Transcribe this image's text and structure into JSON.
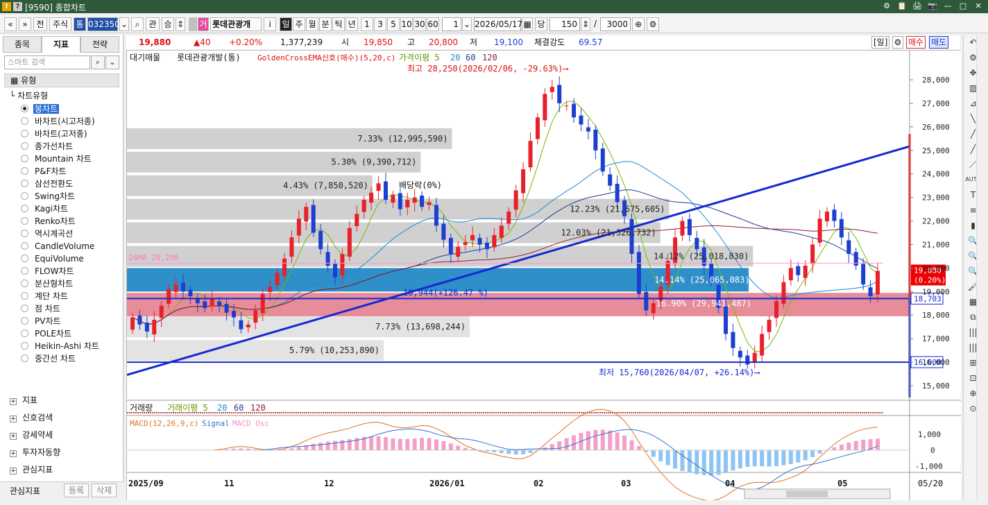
{
  "window": {
    "title": "[9590] 종합차트",
    "icon1": "!",
    "icon2": "?",
    "buttons": [
      "⚙",
      "📋",
      "🖨",
      "📷",
      "—",
      "□",
      "✕"
    ]
  },
  "toolbar": {
    "nav_prev": "«",
    "nav_down": "»",
    "jeon": "전",
    "jusik": "주식",
    "tong": "통",
    "code": "032350",
    "gwan": "관",
    "seung": "승",
    "badge": "거",
    "stock_name": "롯데관광개",
    "info": "i",
    "periods": [
      "일",
      "주",
      "월",
      "분",
      "틱",
      "년"
    ],
    "counts": [
      "1",
      "3",
      "5",
      "10",
      "30",
      "60"
    ],
    "unit": "1",
    "date": "2026/05/17",
    "dang": "당",
    "bars": "150",
    "slash": "/",
    "total": "3000"
  },
  "left_panel": {
    "tabs": [
      "종목",
      "지표",
      "전략"
    ],
    "search_placeholder": "스마트 검색",
    "group": "유형",
    "tree_root": "차트유형",
    "chart_types": [
      "봉차트",
      "바차트(시고저종)",
      "바차트(고저종)",
      "종가선차트",
      "Mountain 차트",
      "P&F차트",
      "삼선전환도",
      "Swing차트",
      "Kagi차트",
      "Renko차트",
      "역시계곡선",
      "CandleVolume",
      "EquiVolume",
      "FLOW차트",
      "분산형차트",
      "계단 차트",
      "점 차트",
      "PV차트",
      "POLE차트",
      "Heikin-Ashi 차트",
      "중간선 차트"
    ],
    "selected": "봉차트",
    "sections": [
      "지표",
      "신호검색",
      "강세약세",
      "투자자동향",
      "관심지표"
    ],
    "bottom_label": "관심지표",
    "bottom_buttons": [
      "등록",
      "삭제"
    ]
  },
  "quote": {
    "price": "19,880",
    "change": "▲40",
    "pct": "+0.20%",
    "volume": "1,377,239",
    "open_label": "시",
    "open": "19,850",
    "high_label": "고",
    "high": "20,800",
    "low_label": "저",
    "low": "19,100",
    "strength_label": "체결강도",
    "strength": "69.57",
    "period_btn": "[일]",
    "buy": "매수",
    "sell": "매도"
  },
  "legend": {
    "items": [
      "대기매물",
      "롯데관광개발(통)",
      "GoldenCrossEMA신호(매수)(5,20,c)",
      "가격이평 5",
      "20",
      "60",
      "120"
    ]
  },
  "colors": {
    "up": "#e8202a",
    "down": "#1d3fd0",
    "ma5": "#7ab800",
    "ma20": "#1a8ad8",
    "ma60": "#1f3a9a",
    "ma120": "#8a2030",
    "trend": "#1428d0",
    "volume_band": "#b0b0b0",
    "blue_band": "#2f8fc8",
    "pink_band": "#e07080"
  },
  "annotations": {
    "high": "최고 28,250(2026/02/06, -29.63%)⟶",
    "low": "최저 15,760(2026/04/07, +26.14%)⟶",
    "dividend": "배당락(0%)",
    "ma_label": "20MA 20,206",
    "band_label": "18,944(+126.47 %)"
  },
  "volume_profile": [
    {
      "label": "7.33% (12,995,590)",
      "price_top": 26000,
      "price_bot": 25000,
      "pct": 7.33
    },
    {
      "label": "5.30% (9,390,712)",
      "price_top": 25000,
      "price_bot": 24000,
      "pct": 5.3
    },
    {
      "label": "4.43% (7,850,520)",
      "price_top": 24000,
      "price_bot": 23000,
      "pct": 4.43
    },
    {
      "label": "12.23% (21,675,605)",
      "price_top": 23000,
      "price_bot": 22000,
      "pct": 12.23
    },
    {
      "label": "12.03% (21,326,732)",
      "price_top": 22000,
      "price_bot": 21000,
      "pct": 12.03
    },
    {
      "label": "14.12% (25,018,830)",
      "price_top": 21000,
      "price_bot": 20000,
      "pct": 14.12
    },
    {
      "label": "14.14% (25,065,083)",
      "price_top": 20000,
      "price_bot": 19000,
      "pct": 14.14
    },
    {
      "label": "16.90% (29,941,487)",
      "price_top": 19000,
      "price_bot": 18000,
      "pct": 16.9
    },
    {
      "label": "7.73% (13,698,244)",
      "price_top": 18000,
      "price_bot": 17000,
      "pct": 7.73
    },
    {
      "label": "5.79% (10,253,890)",
      "price_top": 17000,
      "price_bot": 16000,
      "pct": 5.79
    }
  ],
  "price_axis": {
    "ticks": [
      "28,000",
      "27,000",
      "26,000",
      "25,000",
      "24,000",
      "23,000",
      "22,000",
      "21,000",
      "20,000",
      "19,000",
      "18,000",
      "17,000",
      "16,000",
      "15,000"
    ],
    "current_label": "19,880",
    "current_pct": "(0.20%)",
    "line1": "18,703",
    "line2": "16,000"
  },
  "date_axis": {
    "labels": [
      "2025/09",
      "11",
      "12",
      "2026/01",
      "02",
      "03",
      "04",
      "05"
    ],
    "end": "05/20"
  },
  "volume_panel": {
    "legend": [
      "거래량",
      "거래이평 5",
      "20",
      "60",
      "120"
    ]
  },
  "macd_panel": {
    "legend": [
      "MACD(12,26,9,c)",
      "Signal",
      "MACD Osc"
    ],
    "ticks": [
      "1,000",
      "0",
      "-1,000"
    ]
  },
  "right_tools": [
    "↶",
    "⚙",
    "✥",
    "▥",
    "⊿",
    "╲",
    "╱",
    "╱",
    "／",
    "AUTO",
    "T",
    "≡",
    "▮",
    "🔍",
    "🔍",
    "🔍",
    "🖌",
    "▦",
    "⧉",
    "|||",
    "|||",
    "⊞",
    "⊡",
    "⊕",
    "⊙"
  ]
}
